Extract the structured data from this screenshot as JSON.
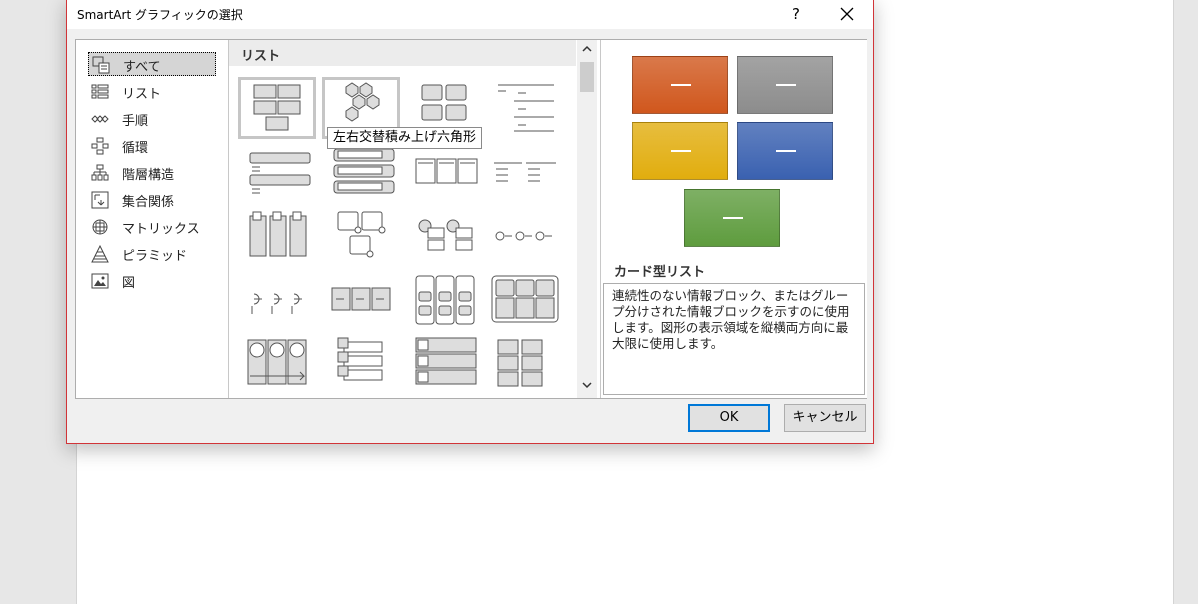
{
  "dialog": {
    "title": "SmartArt グラフィックの選択",
    "help_label": "?",
    "close_label": "✕",
    "ok_label": "OK",
    "cancel_label": "キャンセル"
  },
  "categories": [
    {
      "label": "すべて",
      "icon": "all-icon"
    },
    {
      "label": "リスト",
      "icon": "list-icon"
    },
    {
      "label": "手順",
      "icon": "process-icon"
    },
    {
      "label": "循環",
      "icon": "cycle-icon"
    },
    {
      "label": "階層構造",
      "icon": "hierarchy-icon"
    },
    {
      "label": "集合関係",
      "icon": "relationship-icon"
    },
    {
      "label": "マトリックス",
      "icon": "matrix-icon"
    },
    {
      "label": "ピラミッド",
      "icon": "pyramid-icon"
    },
    {
      "label": "図",
      "icon": "picture-icon"
    }
  ],
  "gallery": {
    "section_title": "リスト",
    "tooltip": "左右交替積み上げ六角形"
  },
  "preview": {
    "title": "カード型リスト",
    "description": "連続性のない情報ブロック、またはグループ分けされた情報ブロックを示すのに使用します。図形の表示領域を縦横両方向に最大限に使用します。",
    "colors": [
      "#d0571d",
      "#8c8c8c",
      "#e1ad0e",
      "#3a61b0",
      "#5e9c3e"
    ]
  }
}
